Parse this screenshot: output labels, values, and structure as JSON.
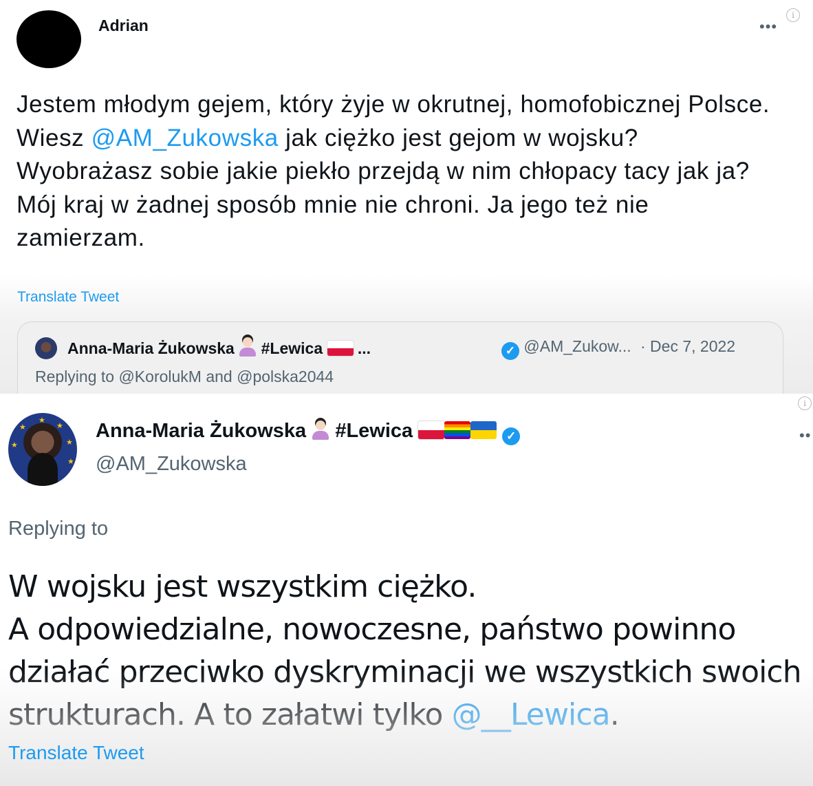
{
  "top_tweet": {
    "author_name": "Adrian",
    "text_before": "Jestem młodym gejem, który żyje w okrutnej, homofobicznej Polsce. Wiesz ",
    "mention": "@AM_Zukowska",
    "text_after": " jak ciężko jest gejom w wojsku? Wyobrażasz sobie jakie piekło przejdą w nim chłopacy tacy jak ja? Mój kraj w żadnej sposób mnie nie chroni. Ja jego też nie zamierzam.",
    "translate_label": "Translate Tweet",
    "more_label": "•••",
    "quote": {
      "name": "Anna-Maria Żukowska",
      "hashtag": "#Lewica",
      "ellipsis": "...",
      "verified_mark": "✓",
      "handle": "@AM_Zukow...",
      "date": "· Dec 7, 2022",
      "replying": "Replying to @KorolukM and @polska2044"
    }
  },
  "bottom_tweet": {
    "name": "Anna-Maria Żukowska",
    "hashtag": "#Lewica",
    "verified_mark": "✓",
    "handle": "@AM_Zukowska",
    "replying": "Replying to",
    "more_label": "••",
    "line1": "W wojsku jest wszystkim ciężko.",
    "line2": "A odpowiedzialne, nowoczesne, państwo powinno",
    "line3": "działać przeciwko dyskryminacji we wszystkich swoich",
    "line4_before": "strukturach. A to załatwi tylko ",
    "line4_mention": "@__Lewica",
    "line4_after": ".",
    "translate_label": "Translate Tweet"
  },
  "icons": {
    "info": "i"
  },
  "colors": {
    "link_blue": "#1d9bf0",
    "secondary_gray": "#536471",
    "text": "#0f1419"
  }
}
